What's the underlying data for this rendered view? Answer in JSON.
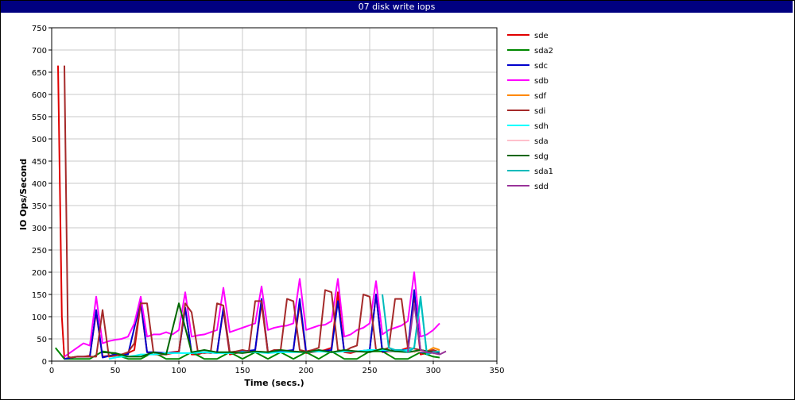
{
  "window": {
    "title": "07 disk write iops"
  },
  "chart_data": {
    "type": "line",
    "title": "07 disk write iops",
    "xlabel": "Time (secs.)",
    "ylabel": "IO Ops/Second",
    "xlim": [
      0,
      350
    ],
    "ylim": [
      0,
      750
    ],
    "xticks": [
      0,
      50,
      100,
      150,
      200,
      250,
      300,
      350
    ],
    "yticks": [
      0,
      50,
      100,
      150,
      200,
      250,
      300,
      350,
      400,
      450,
      500,
      550,
      600,
      650,
      700,
      750
    ],
    "grid": true,
    "legend_position": "right",
    "series": [
      {
        "name": "sde",
        "color": "#e00000",
        "x": [
          5,
          8,
          10,
          15,
          20,
          25,
          30,
          35,
          40,
          45,
          50,
          55,
          60,
          65,
          70,
          75,
          80,
          85,
          90,
          95,
          100,
          105,
          110,
          115,
          120,
          125,
          130,
          135,
          140,
          145,
          150,
          155,
          160,
          165,
          170,
          175,
          180,
          185,
          190,
          195,
          200,
          205,
          210,
          215,
          220,
          225,
          230,
          235,
          240,
          245,
          250,
          255,
          260,
          265,
          270,
          275,
          280,
          285,
          290,
          295,
          300,
          305
        ],
        "y": [
          665,
          100,
          5,
          8,
          10,
          10,
          12,
          110,
          10,
          12,
          15,
          15,
          18,
          25,
          130,
          20,
          15,
          15,
          18,
          20,
          22,
          120,
          15,
          15,
          20,
          18,
          20,
          115,
          15,
          18,
          20,
          22,
          25,
          130,
          18,
          20,
          22,
          22,
          25,
          130,
          18,
          20,
          22,
          25,
          30,
          155,
          20,
          18,
          22,
          22,
          25,
          150,
          20,
          22,
          22,
          25,
          30,
          140,
          15,
          18,
          20,
          22
        ]
      },
      {
        "name": "sda2",
        "color": "#008800",
        "x": [
          3,
          10,
          20,
          30,
          40,
          45,
          50,
          60,
          70,
          80,
          90,
          100,
          110,
          120,
          130,
          140,
          150,
          160,
          170,
          180,
          190,
          200,
          210,
          220,
          230,
          240,
          250,
          260,
          270,
          280,
          290,
          300,
          305
        ],
        "y": [
          30,
          5,
          5,
          5,
          22,
          20,
          15,
          5,
          5,
          20,
          5,
          5,
          20,
          5,
          5,
          20,
          5,
          20,
          5,
          20,
          5,
          20,
          5,
          22,
          5,
          5,
          22,
          22,
          5,
          5,
          20,
          10,
          8
        ]
      },
      {
        "name": "sdc",
        "color": "#0000cc",
        "x": [
          10,
          20,
          30,
          35,
          40,
          50,
          60,
          70,
          75,
          80,
          90,
          100,
          105,
          110,
          120,
          130,
          135,
          140,
          150,
          160,
          165,
          170,
          180,
          190,
          195,
          200,
          210,
          220,
          225,
          230,
          240,
          250,
          255,
          260,
          270,
          280,
          285,
          290,
          300,
          305
        ],
        "y": [
          5,
          10,
          10,
          115,
          8,
          15,
          15,
          135,
          20,
          20,
          18,
          20,
          120,
          18,
          20,
          18,
          120,
          20,
          22,
          25,
          140,
          20,
          22,
          25,
          140,
          22,
          22,
          25,
          135,
          22,
          22,
          25,
          150,
          22,
          25,
          25,
          160,
          20,
          22,
          18
        ]
      },
      {
        "name": "sdb",
        "color": "#ff00ff",
        "x": [
          10,
          15,
          20,
          25,
          30,
          35,
          40,
          45,
          50,
          55,
          60,
          65,
          70,
          75,
          80,
          85,
          90,
          95,
          100,
          105,
          110,
          115,
          120,
          125,
          130,
          135,
          140,
          145,
          150,
          155,
          160,
          165,
          170,
          175,
          180,
          185,
          190,
          195,
          200,
          205,
          210,
          215,
          220,
          225,
          230,
          235,
          240,
          245,
          250,
          255,
          260,
          265,
          270,
          275,
          280,
          285,
          290,
          295,
          300,
          305
        ],
        "y": [
          10,
          20,
          30,
          40,
          35,
          145,
          40,
          45,
          48,
          50,
          55,
          85,
          145,
          55,
          60,
          60,
          65,
          60,
          70,
          155,
          55,
          58,
          60,
          65,
          70,
          165,
          65,
          70,
          75,
          80,
          85,
          168,
          70,
          75,
          78,
          80,
          85,
          185,
          70,
          75,
          80,
          82,
          90,
          185,
          55,
          60,
          70,
          75,
          85,
          180,
          60,
          70,
          75,
          80,
          90,
          200,
          55,
          60,
          70,
          85
        ]
      },
      {
        "name": "sdf",
        "color": "#ff8800",
        "x": [
          285,
          290,
          295,
          300,
          305
        ],
        "y": [
          20,
          25,
          22,
          30,
          25
        ]
      },
      {
        "name": "sdi",
        "color": "#a52a2a",
        "x": [
          10,
          13,
          15,
          20,
          25,
          30,
          35,
          40,
          45,
          50,
          55,
          60,
          65,
          70,
          75,
          80,
          85,
          90,
          95,
          100,
          105,
          110,
          115,
          120,
          125,
          130,
          135,
          140,
          145,
          150,
          155,
          160,
          165,
          170,
          175,
          180,
          185,
          190,
          195,
          200,
          205,
          210,
          215,
          220,
          225,
          230,
          235,
          240,
          245,
          250,
          255,
          260,
          265,
          270,
          275,
          280,
          285,
          290,
          295,
          300,
          305
        ],
        "y": [
          665,
          10,
          8,
          10,
          10,
          10,
          10,
          115,
          10,
          12,
          15,
          20,
          40,
          130,
          130,
          20,
          15,
          15,
          18,
          20,
          130,
          110,
          20,
          18,
          20,
          130,
          125,
          20,
          22,
          25,
          22,
          135,
          135,
          20,
          25,
          25,
          140,
          135,
          25,
          22,
          25,
          30,
          160,
          155,
          25,
          22,
          30,
          35,
          150,
          145,
          25,
          25,
          30,
          140,
          140,
          30,
          28,
          25,
          22,
          25,
          20
        ]
      },
      {
        "name": "sdh",
        "color": "#00ffff",
        "x": [
          45,
          50,
          55,
          60,
          65,
          70,
          75,
          80,
          90,
          100,
          110,
          120,
          130,
          140,
          150,
          160,
          170,
          180,
          190,
          200,
          210,
          220,
          230,
          240,
          250,
          260,
          270,
          280,
          285,
          290,
          295,
          300
        ],
        "y": [
          5,
          8,
          10,
          10,
          12,
          15,
          15,
          15,
          18,
          18,
          18,
          20,
          18,
          18,
          20,
          20,
          18,
          20,
          20,
          20,
          22,
          20,
          22,
          22,
          25,
          25,
          22,
          25,
          30,
          140,
          15,
          20
        ]
      },
      {
        "name": "sda",
        "color": "#ffc0cb",
        "x": [
          280,
          290,
          300,
          305
        ],
        "y": [
          20,
          22,
          20,
          22
        ]
      },
      {
        "name": "sdg",
        "color": "#006600",
        "x": [
          40,
          50,
          60,
          70,
          80,
          90,
          100,
          110,
          120,
          130,
          140,
          150,
          160,
          170,
          180,
          190,
          200,
          210,
          220,
          230,
          240,
          250,
          260,
          270,
          280,
          290,
          300,
          305
        ],
        "y": [
          20,
          18,
          10,
          10,
          20,
          15,
          130,
          20,
          25,
          20,
          20,
          18,
          22,
          20,
          25,
          22,
          20,
          25,
          20,
          25,
          22,
          20,
          28,
          22,
          20,
          25,
          20,
          15
        ]
      },
      {
        "name": "sda1",
        "color": "#00bbbb",
        "x": [
          260,
          265,
          270,
          275,
          280,
          285,
          290,
          295,
          300,
          305
        ],
        "y": [
          150,
          30,
          25,
          25,
          20,
          30,
          145,
          15,
          20,
          22
        ]
      },
      {
        "name": "sdd",
        "color": "#993399",
        "x": [
          280,
          285,
          290,
          295,
          300,
          305,
          310
        ],
        "y": [
          20,
          130,
          25,
          20,
          18,
          15,
          22
        ]
      }
    ]
  }
}
